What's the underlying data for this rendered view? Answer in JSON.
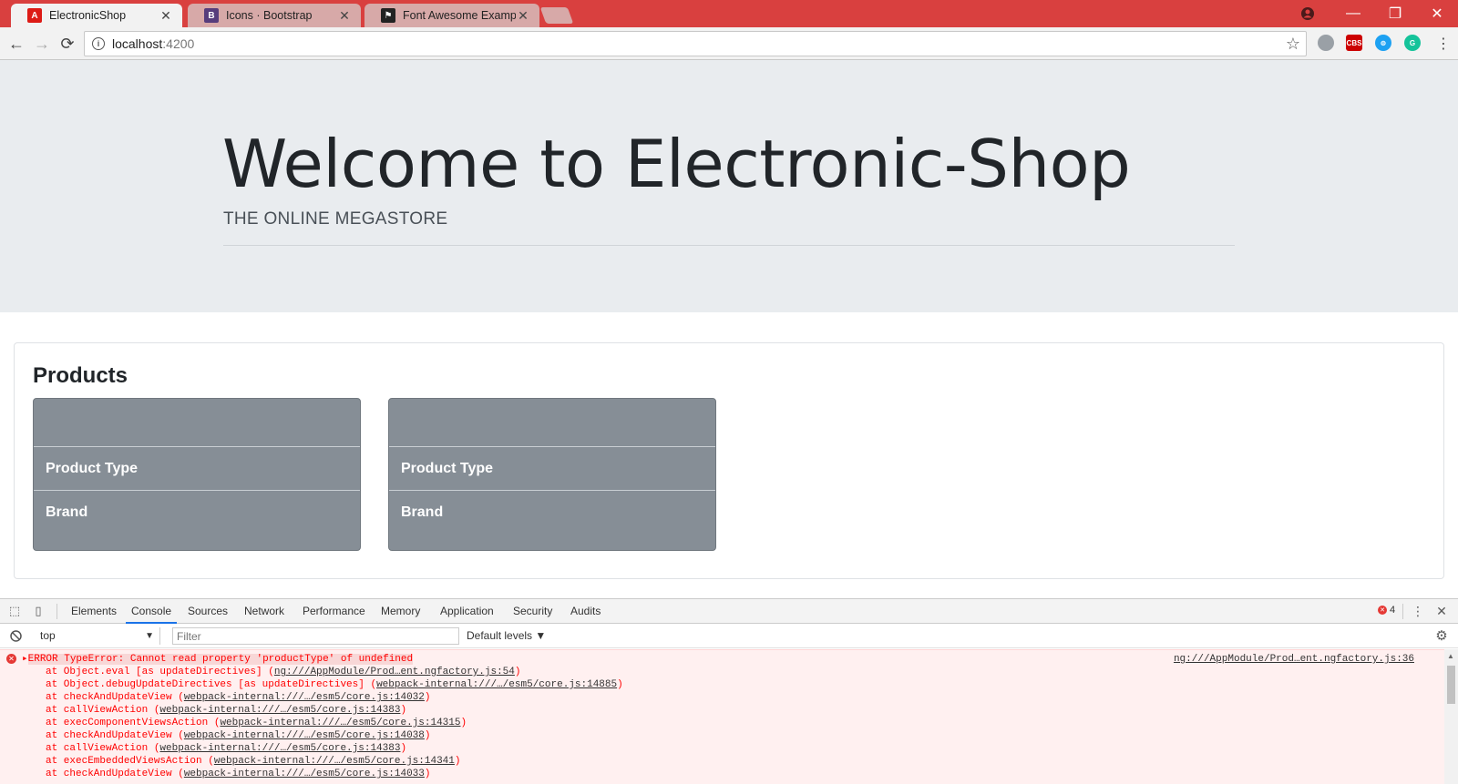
{
  "browser": {
    "tabs": [
      {
        "title": "ElectronicShop",
        "favicon": "angular-icon",
        "active": true
      },
      {
        "title": "Icons · Bootstrap",
        "favicon": "bootstrap-icon",
        "active": false
      },
      {
        "title": "Font Awesome Examples",
        "favicon": "flag-icon",
        "active": false
      }
    ],
    "close_glyph": "✕",
    "address": {
      "host": "localhost",
      "port": ":4200"
    },
    "extensions": [
      "extension-cloud-icon",
      "extension-cbs-icon",
      "extension-blue-icon",
      "grammarly-icon"
    ]
  },
  "page": {
    "jumbotron": {
      "title": "Welcome to Electronic-Shop",
      "subtitle": "THE ONLINE MEGASTORE"
    },
    "products": {
      "heading": "Products",
      "cards": [
        {
          "type_label": "Product Type",
          "brand_label": "Brand"
        },
        {
          "type_label": "Product Type",
          "brand_label": "Brand"
        }
      ]
    }
  },
  "devtools": {
    "tabs": [
      "Elements",
      "Console",
      "Sources",
      "Network",
      "Performance",
      "Memory",
      "Application",
      "Security",
      "Audits"
    ],
    "active_tab": "Console",
    "error_count": "4",
    "context": "top",
    "filter_placeholder": "Filter",
    "levels": "Default levels ▼",
    "error": {
      "message": "ERROR TypeError: Cannot read property 'productType' of undefined",
      "source": "ng:///AppModule/Prod…ent.ngfactory.js:36",
      "stack": [
        {
          "fn": "at Object.eval [as updateDirectives] (",
          "loc": "ng:///AppModule/Prod…ent.ngfactory.js:54",
          "end": ")"
        },
        {
          "fn": "at Object.debugUpdateDirectives [as updateDirectives] (",
          "loc": "webpack-internal:///…/esm5/core.js:14885",
          "end": ")"
        },
        {
          "fn": "at checkAndUpdateView (",
          "loc": "webpack-internal:///…/esm5/core.js:14032",
          "end": ")"
        },
        {
          "fn": "at callViewAction (",
          "loc": "webpack-internal:///…/esm5/core.js:14383",
          "end": ")"
        },
        {
          "fn": "at execComponentViewsAction (",
          "loc": "webpack-internal:///…/esm5/core.js:14315",
          "end": ")"
        },
        {
          "fn": "at checkAndUpdateView (",
          "loc": "webpack-internal:///…/esm5/core.js:14038",
          "end": ")"
        },
        {
          "fn": "at callViewAction (",
          "loc": "webpack-internal:///…/esm5/core.js:14383",
          "end": ")"
        },
        {
          "fn": "at execEmbeddedViewsAction (",
          "loc": "webpack-internal:///…/esm5/core.js:14341",
          "end": ")"
        },
        {
          "fn": "at checkAndUpdateView (",
          "loc": "webpack-internal:///…/esm5/core.js:14033",
          "end": ")"
        }
      ]
    }
  }
}
